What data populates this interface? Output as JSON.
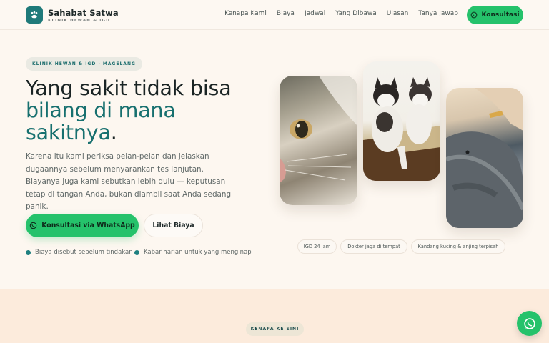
{
  "brand": {
    "name": "Sahabat Satwa",
    "tagline": "KLINIK HEWAN & IGD",
    "logo_icon": "paw-icon"
  },
  "nav": {
    "items": [
      "Kenapa Kami",
      "Biaya",
      "Jadwal",
      "Yang Dibawa",
      "Ulasan",
      "Tanya Jawab"
    ],
    "cta": "Konsultasi",
    "cta_icon": "whatsapp-icon"
  },
  "hero": {
    "eyebrow": "KLINIK HEWAN & IGD · MAGELANG",
    "title_line1": "Yang sakit tidak bisa",
    "title_line2": "bilang di mana",
    "title_line3": "sakitnya",
    "title_period": ".",
    "lead": "Karena itu kami periksa pelan-pelan dan jelaskan dugaannya sebelum menyarankan tes lanjutan. Biayanya juga kami sebutkan lebih dulu — keputusan tetap di tangan Anda, bukan diambil saat Anda sedang panik.",
    "primary_button": "Konsultasi via WhatsApp",
    "secondary_button": "Lihat Biaya",
    "checks": [
      "Biaya disebut sebelum tindakan",
      "Kabar harian untuk yang menginap"
    ]
  },
  "gallery": {
    "photos": [
      "cat-photo",
      "husky-puppies-photo",
      "gray-dog-photo"
    ],
    "tags": [
      "IGD 24 jam",
      "Dokter jaga di tempat",
      "Kandang kucing & anjing terpisah"
    ]
  },
  "next_section": {
    "eyebrow": "KENAPA KE SINI"
  },
  "colors": {
    "accent": "#25c26b",
    "teal": "#17706f",
    "background": "#fdf7f0",
    "section_background": "#fcebdc"
  }
}
